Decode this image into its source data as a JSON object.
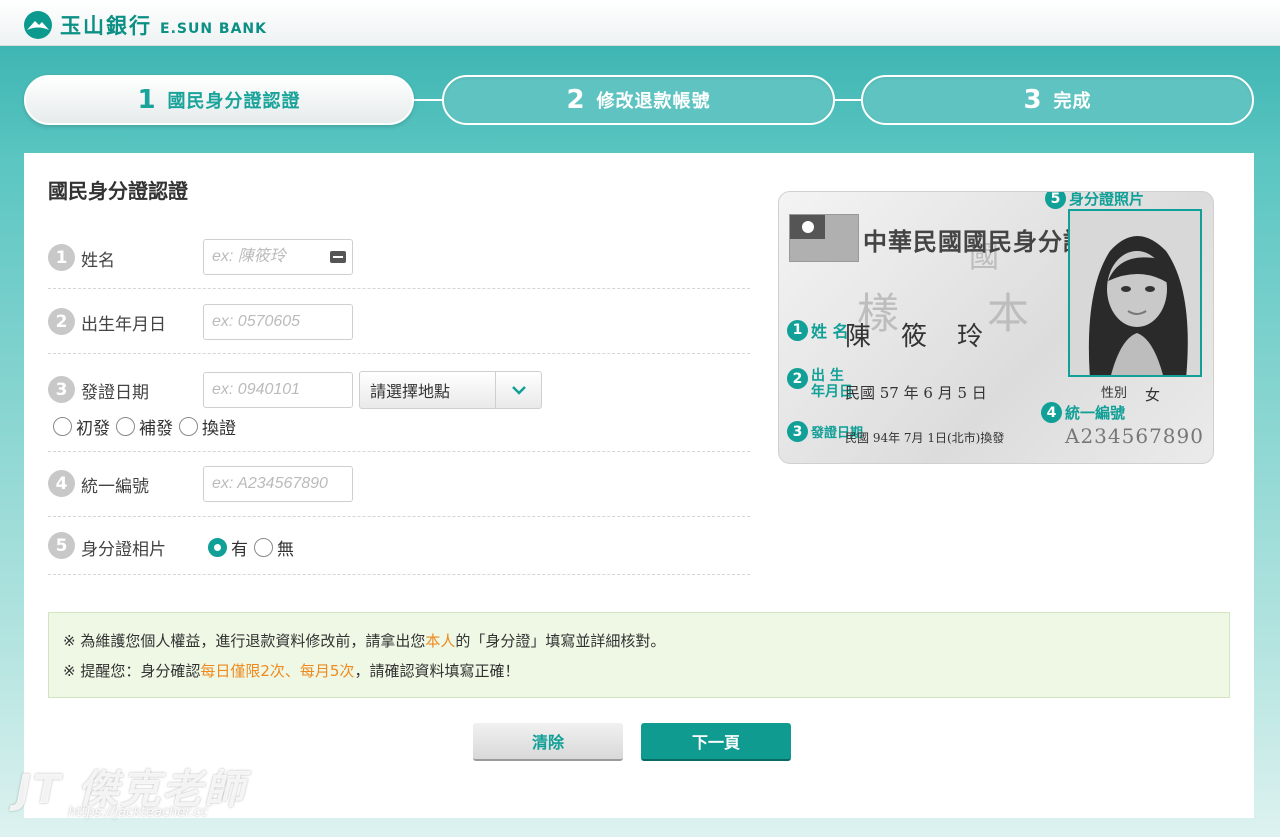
{
  "brand": {
    "name_cn": "玉山銀行",
    "name_en": "E.SUN BANK",
    "logo_icon": "mountain-logo-icon",
    "color": "#0c8f84"
  },
  "steps": [
    {
      "num": "1",
      "label": "國民身分證認證",
      "active": true
    },
    {
      "num": "2",
      "label": "修改退款帳號",
      "active": false
    },
    {
      "num": "3",
      "label": "完成",
      "active": false
    }
  ],
  "form": {
    "title": "國民身分證認證",
    "fields": [
      {
        "num": "1",
        "label": "姓名",
        "placeholder": "ex: 陳筱玲"
      },
      {
        "num": "2",
        "label": "出生年月日",
        "placeholder": "ex: 0570605"
      },
      {
        "num": "3",
        "label": "發證日期",
        "placeholder": "ex: 0940101",
        "select": "請選擇地點",
        "radios": [
          "初發",
          "補發",
          "換證"
        ]
      },
      {
        "num": "4",
        "label": "統一編號",
        "placeholder": "ex: A234567890"
      },
      {
        "num": "5",
        "label": "身分證相片",
        "radios": [
          "有",
          "無"
        ],
        "selected": "有"
      }
    ]
  },
  "id_card": {
    "title": "中華民國國民身分證",
    "sample_1": "樣",
    "sample_2": "本",
    "name_value": "陳　筱　玲",
    "birth_value": "民國 57 年 6 月 5 日",
    "gender_label": "性別",
    "gender_value": "女",
    "issue_value": "民國 94年 7月 1日(北市)換發",
    "id_value": "A234567890",
    "annot_name": "姓 名",
    "annot_birth_1": "出 生",
    "annot_birth_2": "年月日",
    "annot_issue": "發證日期",
    "annot_id": "統一編號",
    "annot_photo": "身分證照片"
  },
  "notice": {
    "line1_a": "※  為維護您個人權益，進行退款資料修改前，請拿出您",
    "line1_b": "本人",
    "line1_c": "的「身分證」填寫並詳細核對。",
    "line2_a": "※  提醒您：身分確認",
    "line2_b": "每日僅限2次、每月5次",
    "line2_c": "，請確認資料填寫正確！",
    "highlight_color": "#ef8a1e"
  },
  "buttons": {
    "clear": "清除",
    "next": "下一頁"
  },
  "watermark": {
    "big": "JT 傑克老師",
    "small": "https://jackteacher.cc"
  }
}
